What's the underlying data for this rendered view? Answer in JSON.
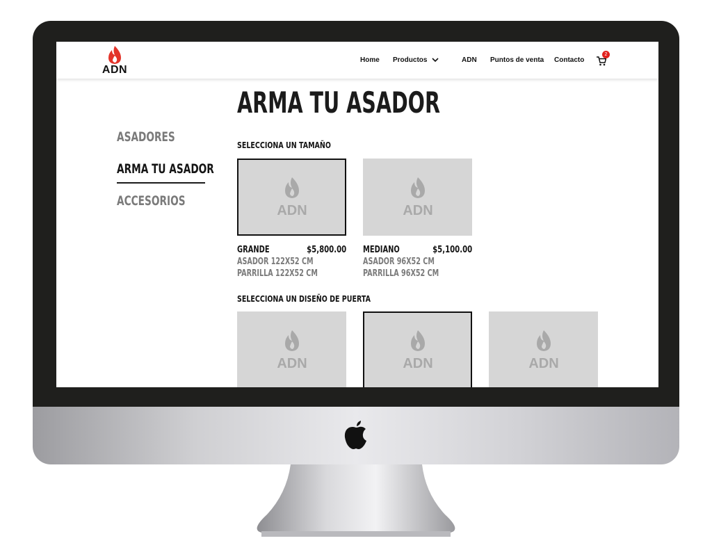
{
  "brand": {
    "logo_text": "ADN",
    "flame_color": "#e3342a"
  },
  "nav": {
    "items": [
      "Home",
      "Productos",
      "ADN",
      "Puntos de venta",
      "Contacto"
    ],
    "cart_count": "2"
  },
  "page": {
    "title": "ARMA TU ASADOR"
  },
  "sidebar": {
    "items": [
      "ASADORES",
      "ARMA TU ASADOR",
      "ACCESORIOS"
    ],
    "active": "ARMA TU ASADOR"
  },
  "size_section": {
    "heading": "SELECCIONA UN TAMAÑO",
    "options": [
      {
        "name": "GRANDE",
        "price": "$5,800.00",
        "line1": "ASADOR 122X52 CM",
        "line2": "PARRILLA 122X52 CM",
        "selected": true,
        "image_label": "ADN"
      },
      {
        "name": "MEDIANO",
        "price": "$5,100.00",
        "line1": "ASADOR 96X52 CM",
        "line2": "PARRILLA 96X52 CM",
        "selected": false,
        "image_label": "ADN"
      }
    ]
  },
  "door_section": {
    "heading": "SELECCIONA UN DISEÑO DE PUERTA",
    "options": [
      {
        "image_label": "ADN",
        "selected": false
      },
      {
        "image_label": "ADN",
        "selected": true
      },
      {
        "image_label": "ADN",
        "selected": false
      }
    ]
  }
}
